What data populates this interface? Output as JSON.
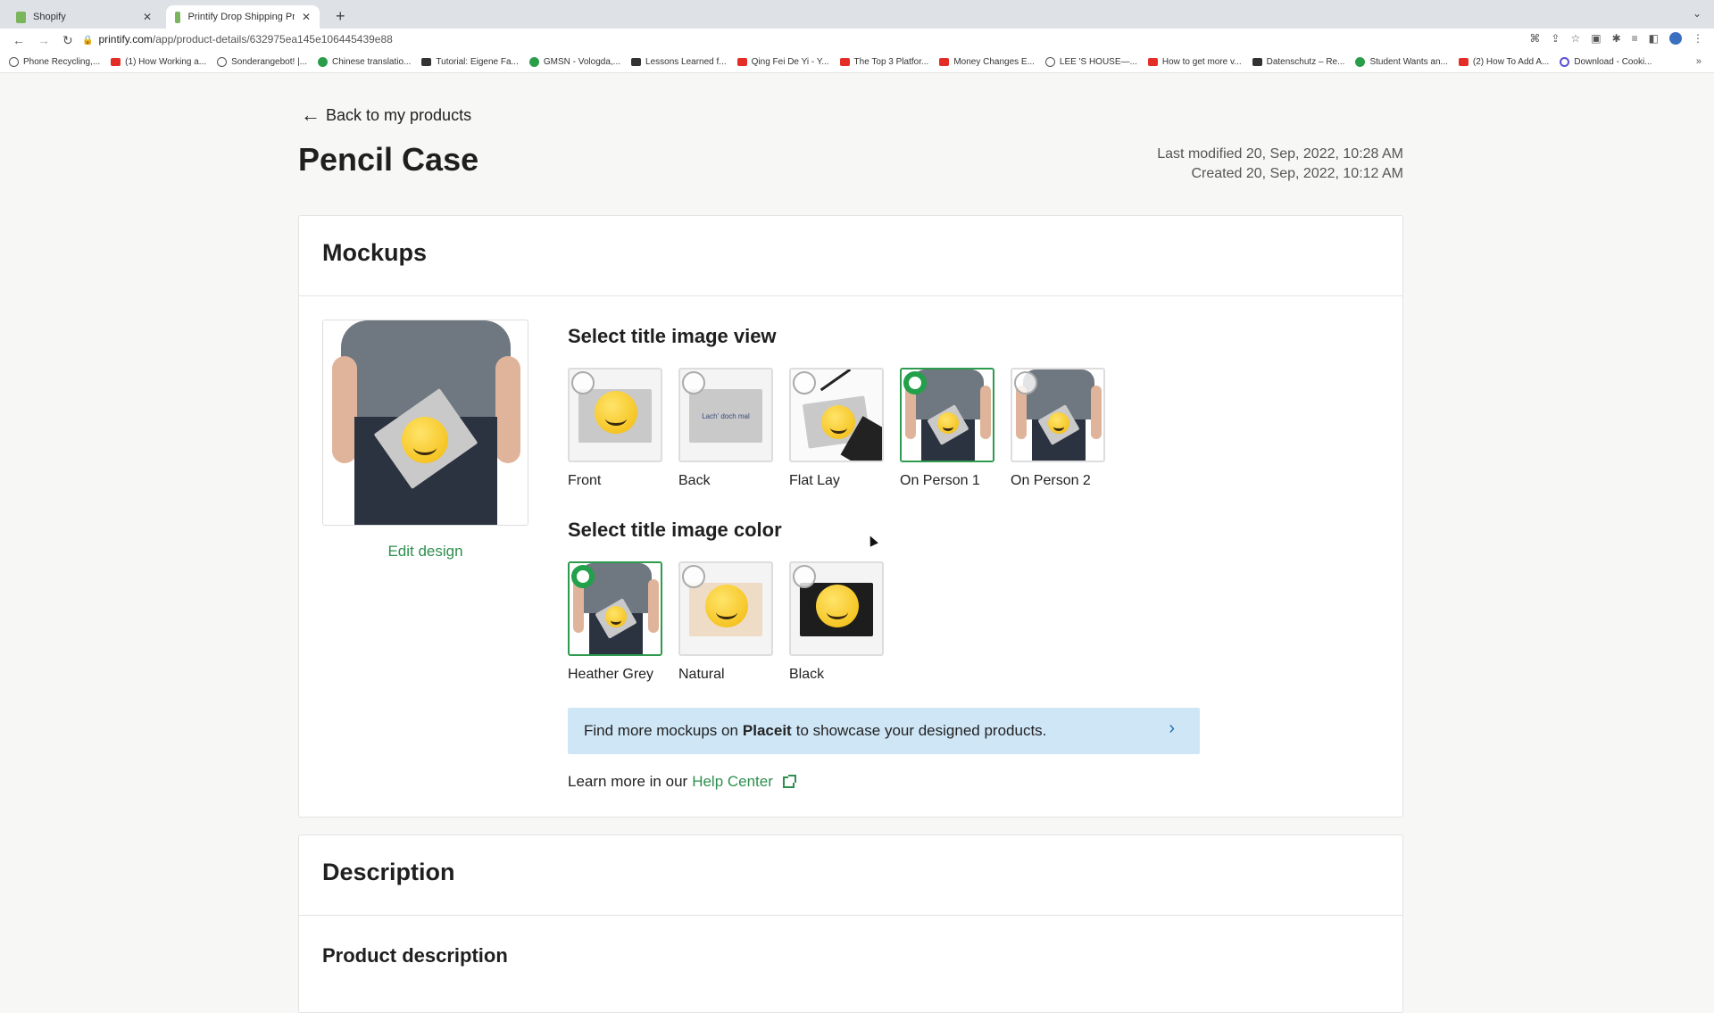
{
  "browser": {
    "tabs": [
      {
        "title": "Shopify",
        "active": false
      },
      {
        "title": "Printify Drop Shipping Print on",
        "active": true
      }
    ],
    "url_domain": "printify.com",
    "url_path": "/app/product-details/632975ea145e106445439e88",
    "bookmarks": [
      "Phone Recycling,...",
      "(1) How Working a...",
      "Sonderangebot! |...",
      "Chinese translatio...",
      "Tutorial: Eigene Fa...",
      "GMSN - Vologda,...",
      "Lessons Learned f...",
      "Qing Fei De Yi - Y...",
      "The Top 3 Platfor...",
      "Money Changes E...",
      "LEE 'S HOUSE—...",
      "How to get more v...",
      "Datenschutz – Re...",
      "Student Wants an...",
      "(2) How To Add A...",
      "Download - Cooki..."
    ],
    "bookmark_icons": [
      "opera",
      "youtube",
      "sonder",
      "fi",
      "hash",
      "up",
      "er",
      "youtube",
      "youtube",
      "youtube",
      "airbnb",
      "youtube",
      "datenschutz",
      "t",
      "youtube",
      "cookie"
    ]
  },
  "header": {
    "back_label": "Back to my products",
    "title": "Pencil Case",
    "last_modified": "Last modified 20, Sep, 2022, 10:28 AM",
    "created": "Created 20, Sep, 2022, 10:12 AM"
  },
  "mockups": {
    "title": "Mockups",
    "edit_design": "Edit design",
    "view_heading": "Select title image view",
    "views": [
      {
        "label": "Front",
        "selected": false
      },
      {
        "label": "Back",
        "selected": false
      },
      {
        "label": "Flat Lay",
        "selected": false
      },
      {
        "label": "On Person 1",
        "selected": true
      },
      {
        "label": "On Person 2",
        "selected": false
      }
    ],
    "back_print_text": "Lach' doch mal",
    "color_heading": "Select title image color",
    "colors": [
      {
        "label": "Heather Grey",
        "selected": true
      },
      {
        "label": "Natural",
        "selected": false
      },
      {
        "label": "Black",
        "selected": false
      }
    ],
    "placeit": {
      "prefix": "Find more mockups on",
      "brand": "Placeit",
      "suffix": "to showcase your designed products."
    },
    "learn_more": "Learn more in our",
    "help_center": "Help Center"
  },
  "description": {
    "title": "Description",
    "subheading": "Product description"
  },
  "colors": {
    "accent": "#2d9a4e",
    "banner": "#cfe6f7",
    "page_bg": "#f7f7f5"
  }
}
